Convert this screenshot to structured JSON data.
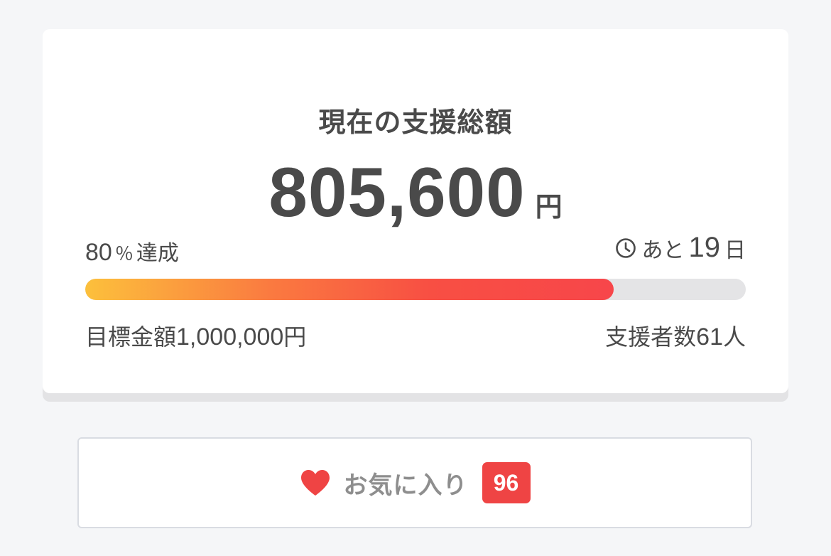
{
  "summary": {
    "title": "現在の支援総額",
    "amount": "805,600",
    "amount_unit": "円"
  },
  "progress": {
    "percent_value": "80",
    "percent_sign": "％",
    "achieved_label": "達成",
    "fill_fraction": 0.8,
    "remaining_prefix": "あと",
    "remaining_days": "19",
    "remaining_unit": "日"
  },
  "goal": {
    "label": "目標金額",
    "amount": "1,000,000",
    "unit": "円"
  },
  "backers": {
    "label": "支援者数",
    "count": "61",
    "unit": "人"
  },
  "favorite": {
    "label": "お気に入り",
    "count": "96"
  },
  "colors": {
    "accent_red": "#ef4444",
    "progress_start": "#fcc03c",
    "progress_end": "#f7464a",
    "track": "#e4e4e6"
  },
  "icons": {
    "clock": "clock-icon",
    "heart": "heart-icon"
  }
}
